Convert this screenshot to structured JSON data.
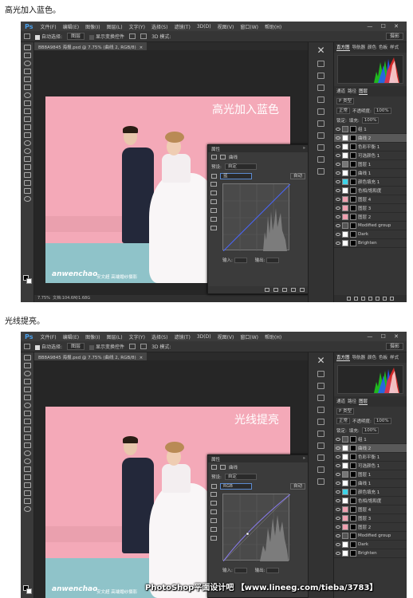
{
  "captions": [
    "高光加入蓝色。",
    "光线提亮。"
  ],
  "app": {
    "logo": "Ps",
    "menu": [
      "文件(F)",
      "编辑(E)",
      "图像(I)",
      "图层(L)",
      "文字(Y)",
      "选择(S)",
      "滤镜(T)",
      "3D(D)",
      "视图(V)",
      "窗口(W)",
      "帮助(H)"
    ],
    "window_controls": "— ☐ ✕"
  },
  "options": {
    "auto_select": "自动选择:",
    "target": "图层",
    "show_transform": "显示变换控件",
    "mode_3d": "3D 模式:",
    "workspace": "摄影"
  },
  "document": {
    "tab": "BB8A9845 海报.psd @ 7.75% (曲线 2, RGB/8)",
    "zoom_status": "7.75%",
    "doc_status": "文档:104.6M/1.68G"
  },
  "photo": {
    "brand": "anwenchao",
    "brand_sub": "安文超 高端婚纱摄影"
  },
  "screens": [
    {
      "title": "高光加入蓝色",
      "channel": "蓝",
      "curve_color": "#4a66ff"
    },
    {
      "title": "光线提亮",
      "channel": "RGB",
      "curve_color": "#8a7cf0"
    }
  ],
  "properties": {
    "title": "属性",
    "header_label": "曲线",
    "preset_label": "预设:",
    "preset_value": "自定",
    "auto_label": "自动",
    "input_label": "输入:",
    "output_label": "输出:"
  },
  "panels": {
    "top_tabs": [
      "直方图",
      "导航器",
      "颜色",
      "色板",
      "样式"
    ],
    "layer_tabs": [
      "通道",
      "路径",
      "图层"
    ],
    "filter_label": "P 类型",
    "blend_mode": "正常",
    "opacity_label": "不透明度:",
    "opacity_value": "100%",
    "lock_label": "锁定:",
    "fill_label": "填充:",
    "fill_value": "100%",
    "layers": [
      {
        "name": "组 1",
        "selected": false,
        "thumb": "#555555"
      },
      {
        "name": "曲线 2",
        "selected": true,
        "thumb": "#ffffff"
      },
      {
        "name": "色彩平衡 1",
        "selected": false,
        "thumb": "#ffffff"
      },
      {
        "name": "可选颜色 1",
        "selected": false,
        "thumb": "#ffffff"
      },
      {
        "name": "图层 1",
        "selected": false,
        "thumb": "#777777"
      },
      {
        "name": "曲线 1",
        "selected": false,
        "thumb": "#ffffff"
      },
      {
        "name": "颜色填充 1",
        "selected": false,
        "thumb": "#3fd4e8"
      },
      {
        "name": "色相/饱和度",
        "selected": false,
        "thumb": "#ffffff"
      },
      {
        "name": "图层 4",
        "selected": false,
        "thumb": "#f0a0b0"
      },
      {
        "name": "图层 3",
        "selected": false,
        "thumb": "#f0a0b0"
      },
      {
        "name": "图层 2",
        "selected": false,
        "thumb": "#f0a0b0"
      },
      {
        "name": "Modified group",
        "selected": false,
        "thumb": "#555555"
      },
      {
        "name": "Dark",
        "selected": false,
        "thumb": "#ffffff"
      },
      {
        "name": "Brighten",
        "selected": false,
        "thumb": "#ffffff"
      }
    ]
  },
  "watermark": "PhotoShop平面设计吧 【www.lineeg.com/tieba/3783】"
}
